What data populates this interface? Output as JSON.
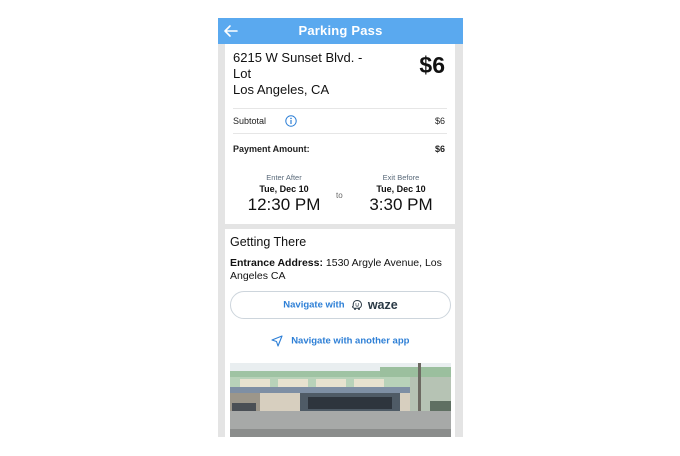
{
  "header": {
    "title": "Parking Pass"
  },
  "summary": {
    "address_line1": "6215 W Sunset Blvd. - Lot",
    "address_line2": "Los Angeles, CA",
    "price": "$6",
    "subtotal_label": "Subtotal",
    "subtotal_value": "$6",
    "payment_label": "Payment Amount:",
    "payment_value": "$6"
  },
  "times": {
    "enter_caption": "Enter After",
    "enter_date": "Tue, Dec 10",
    "enter_time": "12:30 PM",
    "to": "to",
    "exit_caption": "Exit Before",
    "exit_date": "Tue, Dec 10",
    "exit_time": "3:30 PM"
  },
  "getting_there": {
    "title": "Getting There",
    "entrance_label": "Entrance Address:",
    "entrance_value": "1530 Argyle Avenue, Los Angeles CA",
    "waze_button_label": "Navigate with",
    "waze_logo_text": "waze",
    "other_app_label": "Navigate with another app"
  },
  "colors": {
    "header": "#5aa9ef",
    "link": "#2d7fd6"
  }
}
